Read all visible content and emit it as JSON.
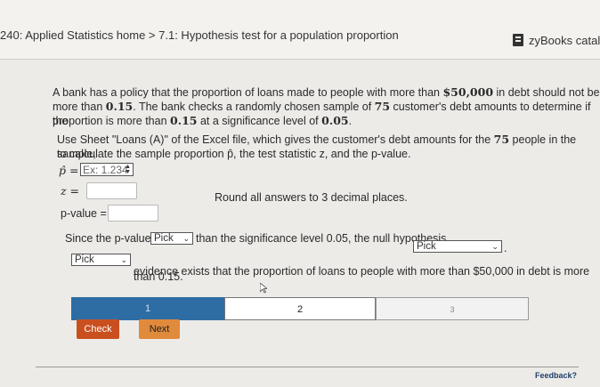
{
  "header": {
    "breadcrumb": "240: Applied Statistics home > 7.1: Hypothesis test for a population proportion",
    "catalog": "zyBooks catalo"
  },
  "problem": {
    "line1": "A bank has a policy that the proportion of loans made to people with more than ",
    "amount": "$50,000",
    "line1b": " in debt should not be",
    "line2a": "more than ",
    "p0": "0.15",
    "line2b": ". The bank checks a randomly chosen sample of ",
    "n": "75",
    "line2c": " customer's debt amounts to determine if the",
    "line3a": "proportion is more than ",
    "line3b": " at a significance level of ",
    "alpha": "0.05",
    "line3c": ".",
    "use1a": "Use Sheet \"Loans (A)\" of the Excel file, which gives the customer's debt amounts for the ",
    "use1b": " people in the sample,",
    "use2": "to calculate the sample proportion p̂, the test statistic z, and the p-value."
  },
  "inputs": {
    "phat_label": "p̂ =",
    "phat_placeholder": "Ex: 1.234",
    "z_label": "z =",
    "round_note": "Round all answers to 3 decimal places.",
    "pvalue_label": "p-value ="
  },
  "conclusion": {
    "since": "Since the p-value is",
    "select1": "Pick",
    "than": "than the significance level 0.05, the null hypothesis",
    "select2": "Pick",
    "period": ".",
    "select3": "Pick",
    "evidence": "evidence exists that the proportion of loans to people with more than $50,000 in debt is more",
    "than2": "than 0.15."
  },
  "tabs": [
    "1",
    "2",
    "3"
  ],
  "buttons": {
    "check": "Check",
    "next": "Next"
  },
  "footer": {
    "feedback": "Feedback?"
  }
}
